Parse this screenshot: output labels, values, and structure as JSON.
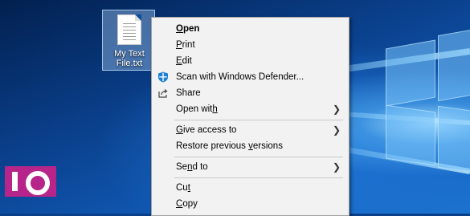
{
  "desktop_icon": {
    "name_line1": "My Text",
    "name_line2": "File.txt"
  },
  "context_menu": {
    "open": "Open",
    "print": "Print",
    "edit": "Edit",
    "scan": "Scan with Windows Defender...",
    "share": "Share",
    "open_with": "Open with",
    "give_access": "Give access to",
    "restore": "Restore previous versions",
    "send_to": "Send to",
    "cut": "Cut",
    "copy": "Copy"
  },
  "watermark": {
    "text": "IO"
  },
  "colors": {
    "menu_bg": "#f2f2f2",
    "accent": "#0078d7",
    "watermark": "#b7258a"
  }
}
